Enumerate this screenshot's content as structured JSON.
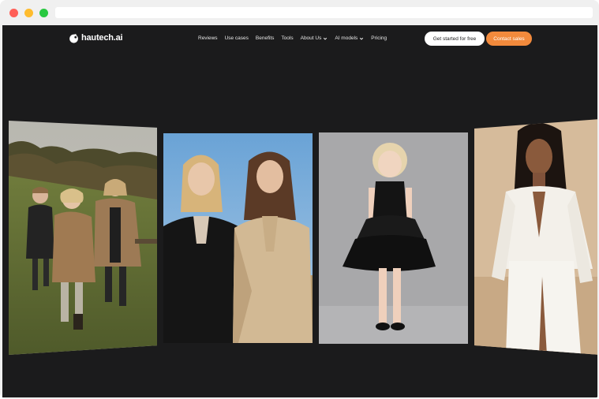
{
  "site": {
    "brand": "hautech.ai"
  },
  "nav": {
    "items": [
      {
        "label": "Reviews",
        "has_dropdown": false
      },
      {
        "label": "Use cases",
        "has_dropdown": false
      },
      {
        "label": "Benefits",
        "has_dropdown": false
      },
      {
        "label": "Tools",
        "has_dropdown": false
      },
      {
        "label": "About Us",
        "has_dropdown": true
      },
      {
        "label": "AI models",
        "has_dropdown": true
      },
      {
        "label": "Pricing",
        "has_dropdown": false
      }
    ],
    "cta_primary": "Get started for free",
    "cta_secondary": "Contact sales"
  },
  "colors": {
    "background": "#1b1b1c",
    "accent": "#f28a3c",
    "chrome": "#f0f0f0"
  },
  "gallery": {
    "images": [
      {
        "subject": "three-children-in-camel-coats-running-in-field"
      },
      {
        "subject": "two-women-in-black-and-beige-blazers"
      },
      {
        "subject": "girl-in-black-tulle-dress"
      },
      {
        "subject": "woman-in-white-silk-blouse-and-skirt"
      }
    ]
  }
}
